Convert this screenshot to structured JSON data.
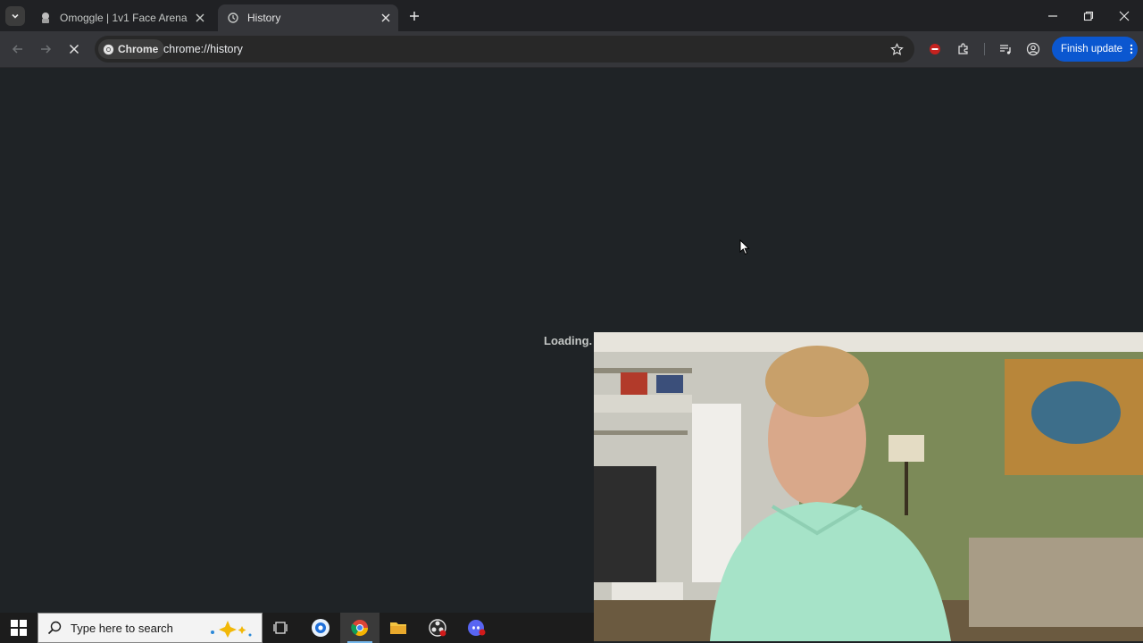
{
  "tabs": [
    {
      "label": "Omoggle | 1v1 Face Arena",
      "active": false,
      "icon": "omoggle-favicon"
    },
    {
      "label": "History",
      "active": true,
      "icon": "history-favicon"
    }
  ],
  "toolbar": {
    "site_chip_label": "Chrome",
    "url": "chrome://history",
    "finish_update_label": "Finish update"
  },
  "content": {
    "loading_text": "Loading."
  },
  "taskbar": {
    "search_placeholder": "Type here to search",
    "apps": [
      "task-view-icon",
      "screen-record-icon",
      "chrome-icon",
      "file-explorer-icon",
      "obs-icon",
      "discord-icon"
    ]
  },
  "colors": {
    "accent": "#0b57d0",
    "page_bg": "#1f2326",
    "toolbar_bg": "#35363a",
    "tabstrip_bg": "#202124"
  }
}
